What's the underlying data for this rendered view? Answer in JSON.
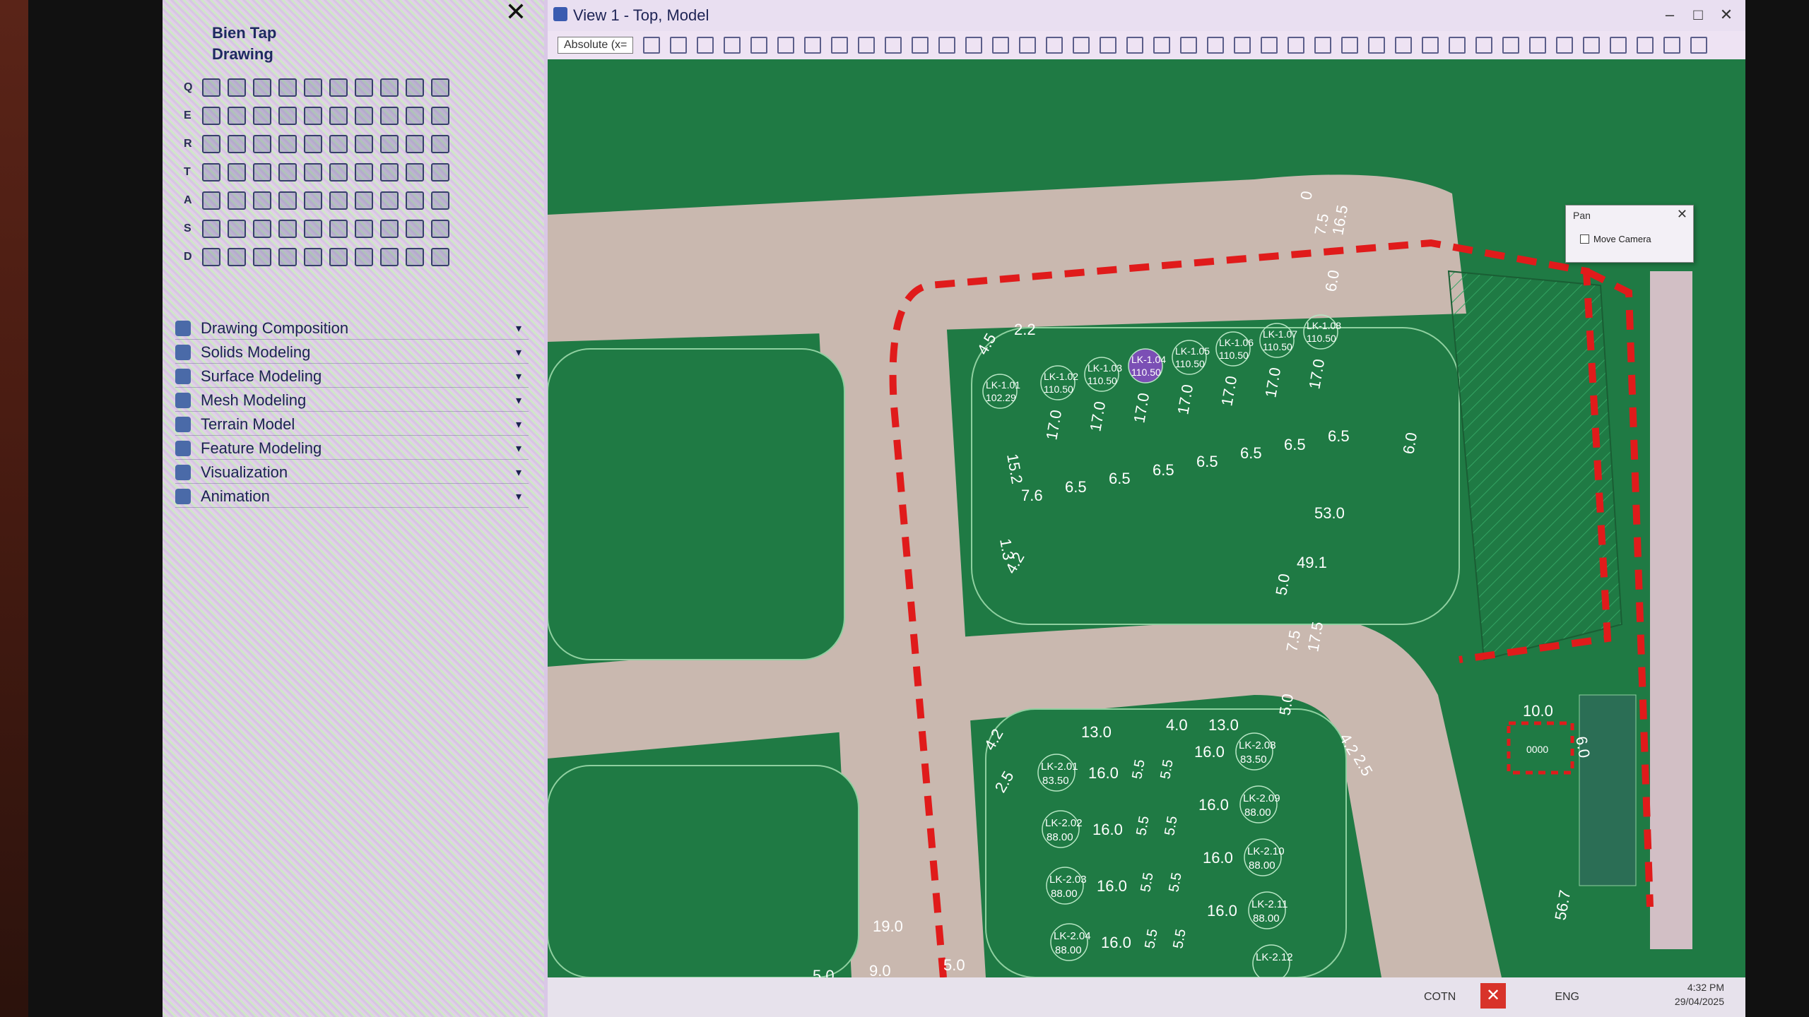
{
  "panel": {
    "section_title": "Bien Tap",
    "drawing_label": "Drawing",
    "tool_rows": [
      "Q",
      "E",
      "R",
      "T",
      "A",
      "S",
      "D"
    ],
    "categories": [
      {
        "label": "Drawing Composition"
      },
      {
        "label": "Solids Modeling"
      },
      {
        "label": "Surface Modeling"
      },
      {
        "label": "Mesh Modeling"
      },
      {
        "label": "Terrain Model"
      },
      {
        "label": "Feature Modeling"
      },
      {
        "label": "Visualization"
      },
      {
        "label": "Animation"
      }
    ],
    "close_icon": "close-icon"
  },
  "view": {
    "title": "View 1 - Top, Model",
    "select_label": "Absolute (x=",
    "pan_dialog": {
      "title": "Pan",
      "checkbox_label": "Move Camera"
    }
  },
  "map": {
    "colors": {
      "lot": "#1f7a44",
      "road": "#c7b8b0",
      "boundary": "#e01b1b",
      "text": "#ffffff",
      "hatch": "#2f9a5c"
    },
    "lots_top": [
      {
        "id": "LK-1.01",
        "elev": "102.29"
      },
      {
        "id": "LK-1.02",
        "elev": "110.50"
      },
      {
        "id": "LK-1.03",
        "elev": "110.50"
      },
      {
        "id": "LK-1.04",
        "elev": "110.50"
      },
      {
        "id": "LK-1.05",
        "elev": "110.50"
      },
      {
        "id": "LK-1.06",
        "elev": "110.50"
      },
      {
        "id": "LK-1.07",
        "elev": "110.50"
      },
      {
        "id": "LK-1.08",
        "elev": "110.50"
      }
    ],
    "lots_top_depths": [
      "17.0",
      "17.0",
      "17.0",
      "17.0",
      "17.0",
      "17.0",
      "17.0"
    ],
    "lots_top_widths": [
      "7.6",
      "6.5",
      "6.5",
      "6.5",
      "6.5",
      "6.5",
      "6.5",
      "6.5"
    ],
    "dim_labels": {
      "d_45": "4.5",
      "d_22": "2.2",
      "d_152": "15.2",
      "d_530": "53.0",
      "d_491": "49.1",
      "d_13": "1.3",
      "d_42": "4.2",
      "d_50a": "5.0",
      "d_75": "7.5",
      "d_175": "17.5",
      "d_60": "6.0",
      "d_75top": "7.5",
      "d_165": "16.5",
      "d_0": "0",
      "d_60r": "6.0",
      "d_50b": "5.0",
      "d_130a": "13.0",
      "d_40": "4.0",
      "d_130b": "13.0",
      "d_42b": "4.2",
      "d_25": "2.5",
      "d_42c": "4.2",
      "d_25b": "2.5",
      "d_190": "19.0",
      "d_90": "9.0",
      "d_50c": "5.0",
      "d_50d": "5.0",
      "d_100": "10.0",
      "d_60s": "6.0",
      "d_567": "56.7"
    },
    "lots_bottom_left": [
      {
        "id": "LK-2.01",
        "elev": "83.50"
      },
      {
        "id": "LK-2.02",
        "elev": "88.00"
      },
      {
        "id": "LK-2.03",
        "elev": "88.00"
      },
      {
        "id": "LK-2.04",
        "elev": "88.00"
      }
    ],
    "lots_bottom_right": [
      {
        "id": "LK-2.08",
        "elev": "83.50"
      },
      {
        "id": "LK-2.09",
        "elev": "88.00"
      },
      {
        "id": "LK-2.10",
        "elev": "88.00"
      },
      {
        "id": "LK-2.11",
        "elev": "88.00"
      },
      {
        "id": "LK-2.12",
        "elev": ""
      }
    ],
    "bottom_depth": "16.0",
    "bottom_width": "5.5",
    "small_box_label": "0000"
  },
  "statusbar": {
    "layer": "COTN",
    "lang": "ENG",
    "time": "4:32 PM",
    "date": "29/04/2025"
  }
}
